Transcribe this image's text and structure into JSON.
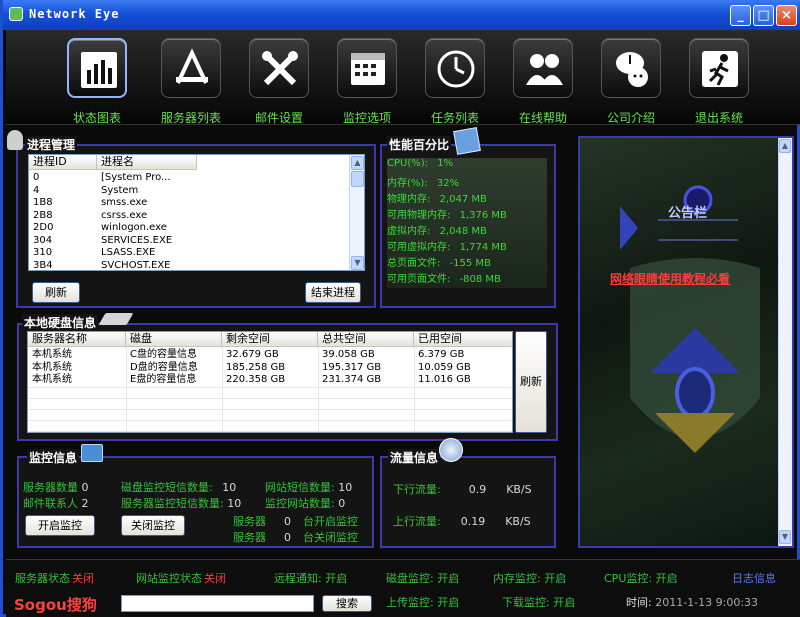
{
  "window": {
    "title": "Network Eye",
    "min": "_",
    "max": "□",
    "close": "×"
  },
  "toolbar": [
    {
      "label": "状态图表",
      "icon": "bar-chart-icon"
    },
    {
      "label": "服务器列表",
      "icon": "server-tools-icon"
    },
    {
      "label": "邮件设置",
      "icon": "wrench-icon"
    },
    {
      "label": "监控选项",
      "icon": "calendar-icon"
    },
    {
      "label": "任务列表",
      "icon": "clock-icon"
    },
    {
      "label": "在线帮助",
      "icon": "users-icon"
    },
    {
      "label": "公司介绍",
      "icon": "chat-icon"
    },
    {
      "label": "退出系统",
      "icon": "running-man-icon"
    }
  ],
  "process": {
    "title": "进程管理",
    "headers": [
      "进程ID",
      "进程名"
    ],
    "rows": [
      [
        "0",
        "[System Pro..."
      ],
      [
        "4",
        "System"
      ],
      [
        "1B8",
        "smss.exe"
      ],
      [
        "2B8",
        "csrss.exe"
      ],
      [
        "2D0",
        "winlogon.exe"
      ],
      [
        "304",
        "SERVICES.EXE"
      ],
      [
        "310",
        "LSASS.EXE"
      ],
      [
        "3B4",
        "SVCHOST.EXE"
      ]
    ],
    "refresh": "刷新",
    "kill": "结束进程"
  },
  "perf": {
    "title": "性能百分比",
    "rows": [
      {
        "label": "CPU(%)",
        "value": "1%"
      },
      {
        "label": "内存(%)",
        "value": "32%"
      },
      {
        "label": "物理内存",
        "value": "2,047 MB"
      },
      {
        "label": "可用物理内存",
        "value": "1,376 MB"
      },
      {
        "label": "虚拟内存",
        "value": "2,048 MB"
      },
      {
        "label": "可用虚拟内存",
        "value": "1,774 MB"
      },
      {
        "label": "总页面文件",
        "value": "-155 MB"
      },
      {
        "label": "可用页面文件",
        "value": "-808 MB"
      }
    ]
  },
  "disk": {
    "title": "本地硬盘信息",
    "headers": [
      "服务器名称",
      "磁盘",
      "剩余空间",
      "总共空间",
      "已用空间"
    ],
    "rows": [
      [
        "本机系统",
        "C盘的容量信息",
        "32.679 GB",
        "39.058 GB",
        "6.379 GB"
      ],
      [
        "本机系统",
        "D盘的容量信息",
        "185.258 GB",
        "195.317 GB",
        "10.059 GB"
      ],
      [
        "本机系统",
        "E盘的容量信息",
        "220.358 GB",
        "231.374 GB",
        "11.016 GB"
      ]
    ],
    "refresh": "刷新"
  },
  "monitor": {
    "title": "监控信息",
    "server_count_label": "服务器数量",
    "server_count": "0",
    "contacts_label": "邮件联系人",
    "contacts": "2",
    "disk_sms_label": "磁盘监控短信数量:",
    "disk_sms": "10",
    "server_sms_label": "服务器监控短信数量:",
    "server_sms": "10",
    "site_sms_label": "网站短信数量:",
    "site_sms": "10",
    "site_count_label": "监控网站数量:",
    "site_count": "0",
    "start": "开启监控",
    "stop": "关闭监控",
    "srv_on_a": "服务器",
    "srv_on_n": "0",
    "srv_on_b": "台开启监控",
    "srv_off_a": "服务器",
    "srv_off_n": "0",
    "srv_off_b": "台关闭监控"
  },
  "traffic": {
    "title": "流量信息",
    "down_label": "下行流量:",
    "down": "0.9",
    "down_unit": "KB/S",
    "up_label": "上行流量:",
    "up": "0.19",
    "up_unit": "KB/S"
  },
  "bulletin": {
    "title": "公告栏",
    "link": "网络眼睛使用教程必看"
  },
  "status": {
    "server_state_label": "服务器状态",
    "server_state": "关闭",
    "site_state_label": "网站监控状态",
    "site_state": "关闭",
    "item3_label": "远程通知",
    "item3": "开启",
    "item4_label": "磁盘监控",
    "item4": "开启",
    "item5_label": "内存监控",
    "item5": "开启",
    "item6_label": "CPU监控",
    "item6": "开启",
    "log": "日志信息",
    "item7_label": "上传监控",
    "item7": "开启",
    "item8_label": "下载监控",
    "item8": "开启",
    "time_label": "时间:",
    "time": "2011-1-13 9:00:33",
    "logo": "Sogou搜狗",
    "search_btn": "搜索",
    "search_value": ""
  },
  "colors": {
    "accent": "#3a3aa8",
    "green": "#35c23a",
    "red": "#ff3b3b"
  }
}
